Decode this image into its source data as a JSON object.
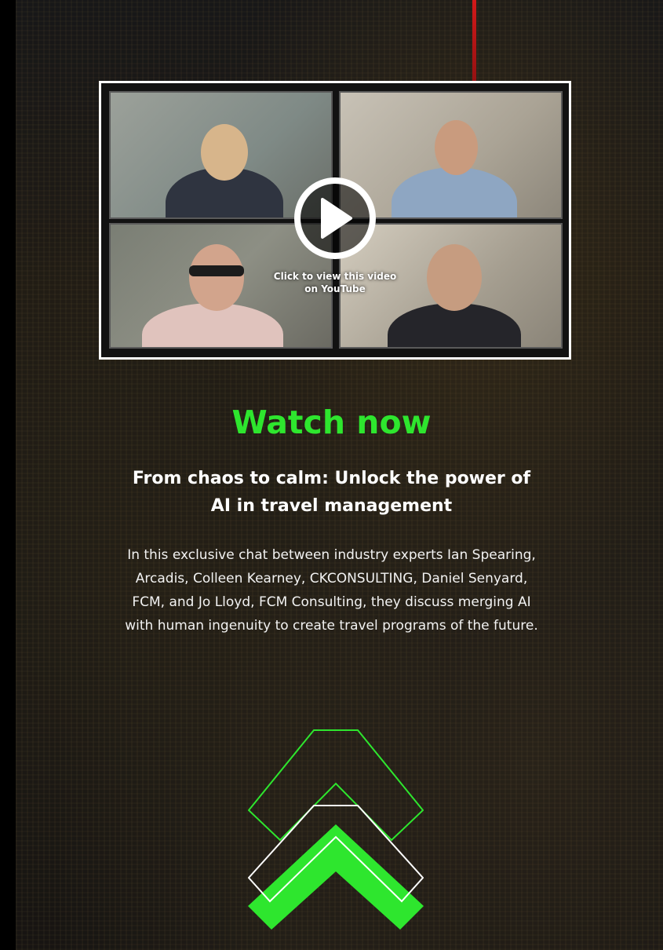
{
  "video": {
    "caption": "Click to view this video on YouTube",
    "play_icon": "play-icon",
    "border_color": "#ffffff"
  },
  "headline": "Watch now",
  "subtitle": "From chaos to calm: Unlock the power of AI in travel management",
  "description": "In this exclusive chat between industry experts Ian Spearing, Arcadis, Colleen Kearney, CKCONSULTING, Daniel Senyard, FCM, and Jo Lloyd, FCM Consulting, they discuss merging AI with human ingenuity to create travel programs of the future.",
  "decor": {
    "chevron_icon": "double-chevron-up-icon",
    "accent_color": "#2ee62e"
  }
}
